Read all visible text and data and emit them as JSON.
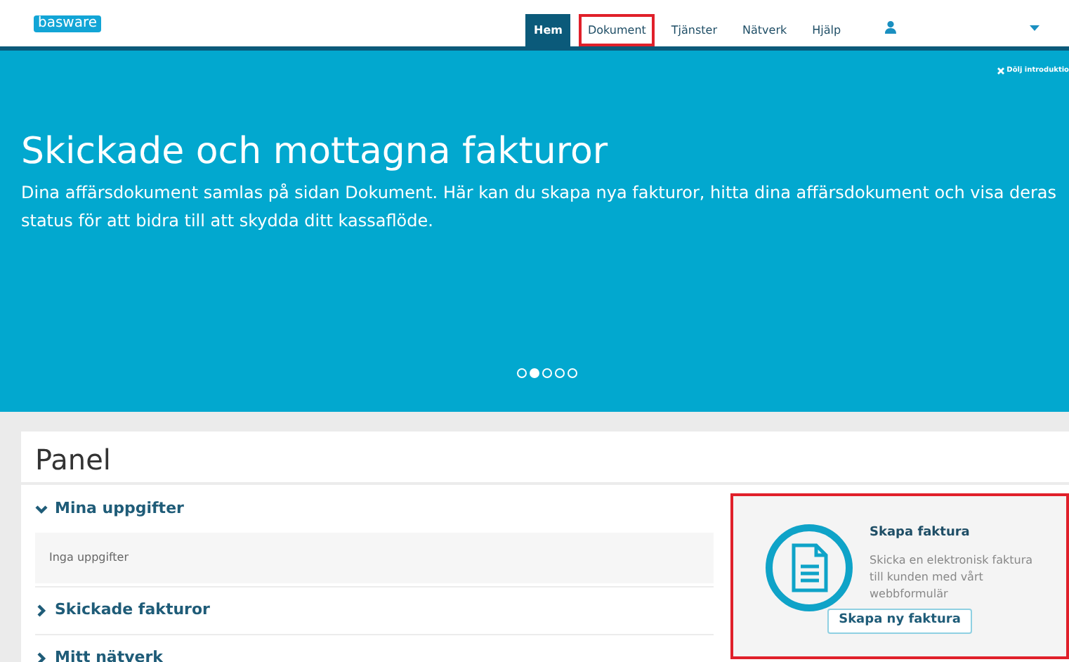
{
  "logo": "basware",
  "nav": [
    {
      "label": "Hem",
      "selected": true,
      "highlighted": false
    },
    {
      "label": "Dokument",
      "selected": false,
      "highlighted": true
    },
    {
      "label": "Tjänster",
      "selected": false,
      "highlighted": false
    },
    {
      "label": "Nätverk",
      "selected": false,
      "highlighted": false
    },
    {
      "label": "Hjälp",
      "selected": false,
      "highlighted": false
    }
  ],
  "hero": {
    "close_label": "Dölj introduktio",
    "title": "Skickade och mottagna fakturor",
    "text": "Dina affärsdokument samlas på sidan Dokument. Här kan du skapa nya fakturor, hitta dina affärsdokument och visa deras status för att bidra till att skydda ditt kassaflöde.",
    "dots": [
      {
        "selected": false
      },
      {
        "selected": true
      },
      {
        "selected": false
      },
      {
        "selected": false
      },
      {
        "selected": false
      }
    ]
  },
  "panel": {
    "title": "Panel",
    "sections": [
      {
        "label": "Mina uppgifter",
        "expanded": true,
        "content": "Inga uppgifter"
      },
      {
        "label": "Skickade fakturor",
        "expanded": false
      },
      {
        "label": "Mitt nätverk",
        "expanded": false
      }
    ],
    "card": {
      "title": "Skapa faktura",
      "text": "Skicka en elektronisk faktura till kunden med vårt webbformulär",
      "button": "Skapa ny faktura",
      "highlighted": true
    }
  }
}
